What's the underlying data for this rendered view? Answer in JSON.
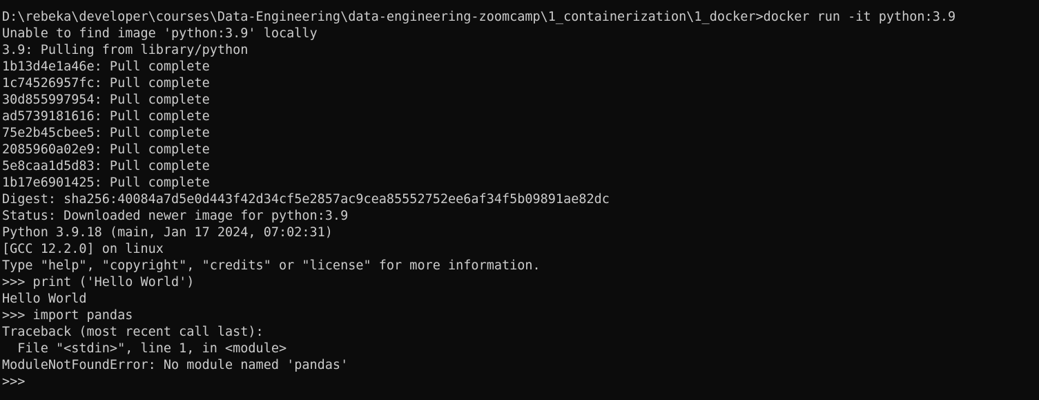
{
  "terminal": {
    "lines": [
      "D:\\rebeka\\developer\\courses\\Data-Engineering\\data-engineering-zoomcamp\\1_containerization\\1_docker>docker run -it python:3.9",
      "Unable to find image 'python:3.9' locally",
      "3.9: Pulling from library/python",
      "1b13d4e1a46e: Pull complete",
      "1c74526957fc: Pull complete",
      "30d855997954: Pull complete",
      "ad5739181616: Pull complete",
      "75e2b45cbee5: Pull complete",
      "2085960a02e9: Pull complete",
      "5e8caa1d5d83: Pull complete",
      "1b17e6901425: Pull complete",
      "Digest: sha256:40084a7d5e0d443f42d34cf5e2857ac9cea85552752ee6af34f5b09891ae82dc",
      "Status: Downloaded newer image for python:3.9",
      "Python 3.9.18 (main, Jan 17 2024, 07:02:31)",
      "[GCC 12.2.0] on linux",
      "Type \"help\", \"copyright\", \"credits\" or \"license\" for more information.",
      ">>> print ('Hello World')",
      "Hello World",
      ">>> import pandas",
      "Traceback (most recent call last):",
      "  File \"<stdin>\", line 1, in <module>",
      "ModuleNotFoundError: No module named 'pandas'"
    ],
    "prompt": ">>> "
  },
  "colors": {
    "background": "#0c0c0c",
    "foreground": "#cccccc"
  }
}
